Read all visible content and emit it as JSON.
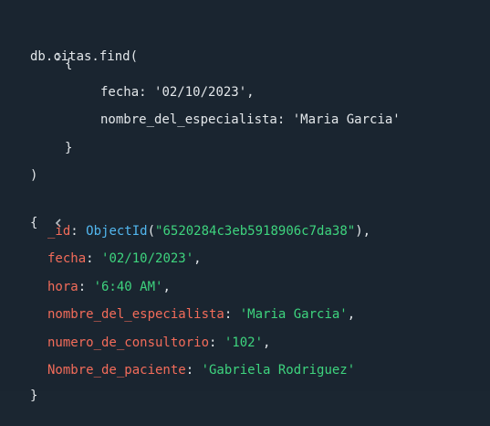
{
  "input": {
    "prompt_icon": "chevron-right-icon",
    "line1": "db.citas.find(",
    "line2": "{",
    "line3_key": "fecha",
    "line3_sep": ": ",
    "line3_val": "'02/10/2023'",
    "line3_end": ",",
    "line4_key": "nombre_del_especialista",
    "line4_sep": ": ",
    "line4_val": "'Maria Garcia'",
    "line5": "}",
    "line6": ")"
  },
  "output": {
    "prompt_icon": "chevron-left-icon",
    "open_brace": "{",
    "close_brace": "}",
    "id_key": "_id",
    "id_fn": "ObjectId",
    "id_open": "(",
    "id_value": "\"6520284c3eb5918906c7da38\"",
    "id_close": "),",
    "fields": [
      {
        "key": "fecha",
        "value": "'02/10/2023'",
        "end": ","
      },
      {
        "key": "hora",
        "value": "'6:40 AM'",
        "end": ","
      },
      {
        "key": "nombre_del_especialista",
        "value": "'Maria Garcia'",
        "end": ","
      },
      {
        "key": "numero_de_consultorio",
        "value": "'102'",
        "end": ","
      },
      {
        "key": "Nombre_de_paciente",
        "value": "'Gabriela Rodriguez'",
        "end": ""
      }
    ],
    "colon": ": "
  },
  "colors": {
    "background": "#1a2530",
    "key": "#f36c5a",
    "string": "#3ed47e",
    "function": "#52b7ef",
    "text": "#e3e7ea"
  }
}
